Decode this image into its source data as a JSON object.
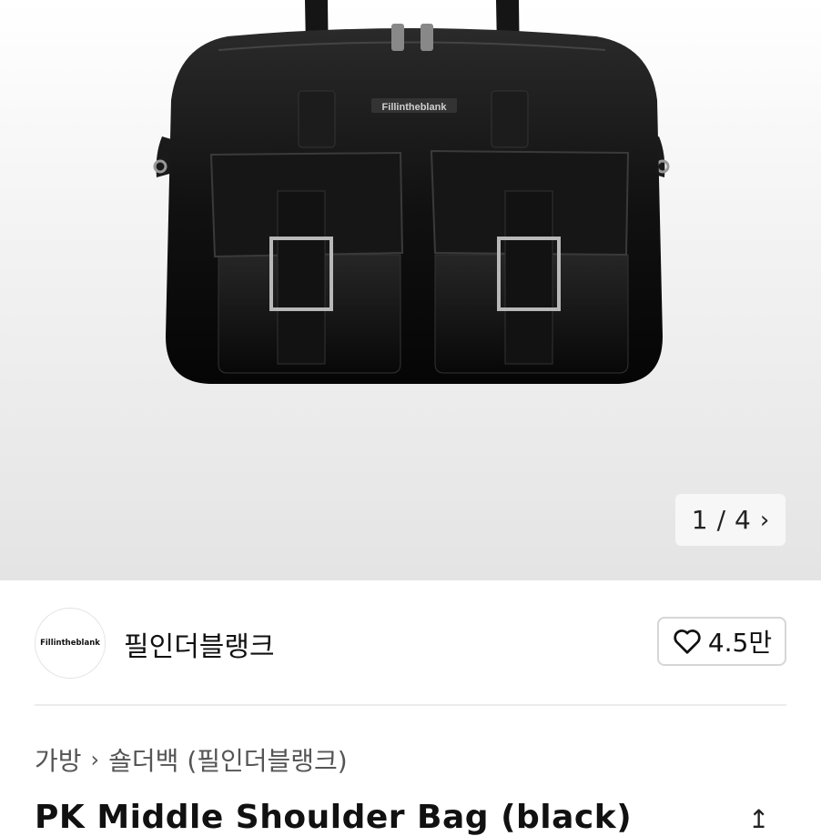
{
  "gallery": {
    "image_alt": "Fillintheblank black leather shoulder bag",
    "logo_text": "Fillintheblank",
    "current": "1",
    "separator": "/",
    "total": "4",
    "next_icon": "chevron-right-icon"
  },
  "brand": {
    "logo_text": "Fillintheblank",
    "name": "필인더블랭크",
    "like_icon": "heart-icon",
    "like_count": "4.5만"
  },
  "breadcrumb": {
    "category": "가방",
    "separator": "›",
    "subcategory": "숄더백 (필인더블랭크)"
  },
  "product": {
    "title": "PK Middle Shoulder Bag (black)",
    "share_icon": "share-icon"
  }
}
